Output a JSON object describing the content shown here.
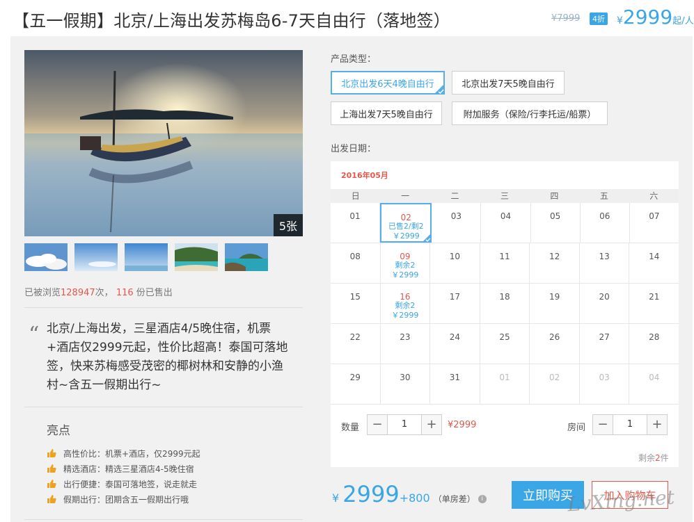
{
  "header": {
    "title": "【五一假期】北京/上海出发苏梅岛6-7天自由行（落地签）",
    "old_price": "¥7999",
    "discount_badge": "4折",
    "price_yen": "¥",
    "price": "2999",
    "price_unit": "起/人"
  },
  "gallery": {
    "image_count": "5张",
    "thumbnails": [
      "thumb-clouds",
      "thumb-sky",
      "thumb-sky-2",
      "thumb-island",
      "thumb-island-2"
    ]
  },
  "stats": {
    "prefix": "已被浏览",
    "views": "128947",
    "mid": "次，",
    "sold": "116",
    "suffix": "份已售出"
  },
  "description": "北京/上海出发，三星酒店4/5晚住宿，机票+酒店仅2999元起，性价比超高！泰国可落地签，快来苏梅感受茂密的椰树林和安静的小渔村~含五一假期出行~",
  "highlights": {
    "title": "亮点",
    "items": [
      "高性价比：机票+酒店，仅2999元起",
      "精选酒店：精选三星酒店4-5晚住宿",
      "出行便捷：泰国可落地签，说走就走",
      "假期出行：团期含五一假期出行哦"
    ]
  },
  "product_type": {
    "label": "产品类型：",
    "options": [
      "北京出发6天4晚自由行",
      "北京出发7天5晚自由行",
      "上海出发7天5晚自由行",
      "附加服务（保险/行李托运/船票）"
    ]
  },
  "departure": {
    "label": "出发日期：",
    "month": "2016年05月",
    "weekdays": [
      "日",
      "一",
      "二",
      "三",
      "四",
      "五",
      "六"
    ],
    "weeks": [
      [
        {
          "d": "01"
        },
        {
          "d": "02",
          "info1": "已售2/剩2",
          "info2": "￥2999"
        },
        {
          "d": "03"
        },
        {
          "d": "04"
        },
        {
          "d": "05"
        },
        {
          "d": "06"
        },
        {
          "d": "07"
        }
      ],
      [
        {
          "d": "08"
        },
        {
          "d": "09",
          "info1": "剩余2",
          "info2": "￥2999"
        },
        {
          "d": "10"
        },
        {
          "d": "11"
        },
        {
          "d": "12"
        },
        {
          "d": "13"
        },
        {
          "d": "14"
        }
      ],
      [
        {
          "d": "15"
        },
        {
          "d": "16",
          "info1": "剩余2",
          "info2": "￥2999"
        },
        {
          "d": "17"
        },
        {
          "d": "18"
        },
        {
          "d": "19"
        },
        {
          "d": "20"
        },
        {
          "d": "21"
        }
      ],
      [
        {
          "d": "22"
        },
        {
          "d": "23"
        },
        {
          "d": "24"
        },
        {
          "d": "25"
        },
        {
          "d": "26"
        },
        {
          "d": "27"
        },
        {
          "d": "28"
        }
      ],
      [
        {
          "d": "29"
        },
        {
          "d": "30"
        },
        {
          "d": "31"
        },
        {
          "d": "01"
        },
        {
          "d": "02"
        },
        {
          "d": "03"
        },
        {
          "d": "04"
        }
      ]
    ]
  },
  "quantity": {
    "label": "数量",
    "minus": "−",
    "value": "1",
    "plus": "+",
    "price": "¥2999"
  },
  "rooms": {
    "label": "房间",
    "minus": "−",
    "value": "1",
    "plus": "+"
  },
  "remaining": {
    "prefix": "剩余",
    "count": "2",
    "suffix": "件"
  },
  "total": {
    "yen": "¥",
    "price": "2999",
    "extra": "+800",
    "note": "（单房差）",
    "info": "i"
  },
  "actions": {
    "buy_now": "立即购买",
    "add_to_cart": "加入购物车"
  },
  "watermark": "LvXing.net",
  "colors": {
    "accent_blue": "#3aa6e6",
    "accent_red": "#e4574b",
    "panel_bg": "#f1f1f1"
  }
}
